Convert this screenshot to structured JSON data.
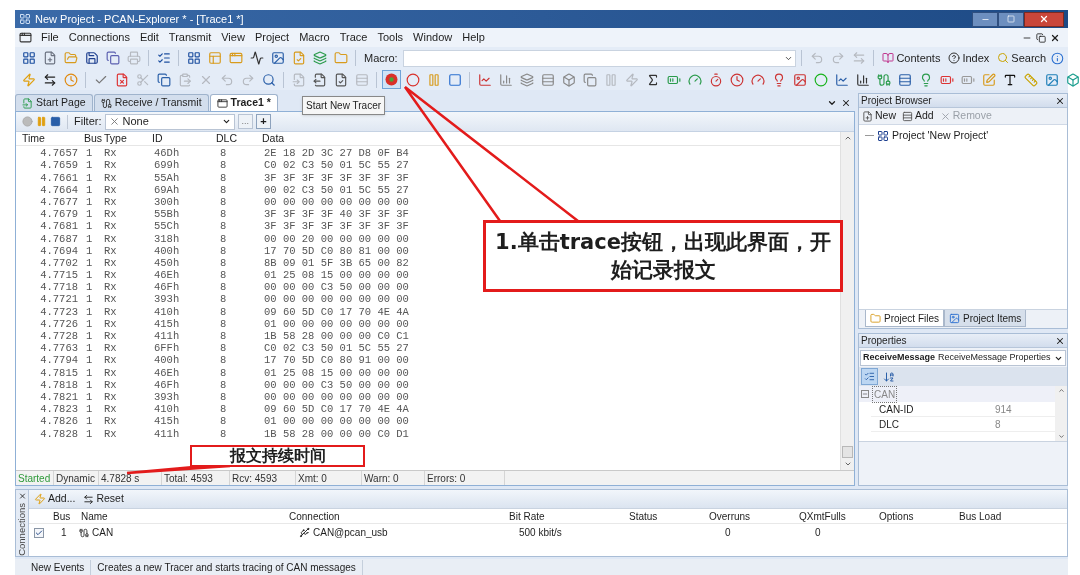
{
  "window": {
    "title": "New Project - PCAN-Explorer * - [Trace1 *]"
  },
  "menu": [
    "File",
    "Connections",
    "Edit",
    "Transmit",
    "View",
    "Project",
    "Macro",
    "Trace",
    "Tools",
    "Window",
    "Help"
  ],
  "toolbar": {
    "macro_label": "Macro:",
    "help_items": [
      "Contents",
      "Index",
      "Search"
    ]
  },
  "tracer_button": {
    "selected": true,
    "tooltip": "Start New Tracer"
  },
  "tabs": [
    {
      "label": "Start Page",
      "selected": false
    },
    {
      "label": "Receive / Transmit",
      "selected": false
    },
    {
      "label": "Trace1 *",
      "selected": true
    }
  ],
  "trace": {
    "filter_label": "Filter:",
    "filter_value": "None",
    "filter_more": "...",
    "filter_add": "+",
    "columns": [
      "Time",
      "Bus",
      "Type",
      "ID",
      "DLC",
      "Data"
    ],
    "rows": [
      [
        "4.7657",
        "1",
        "Rx",
        "46Dh",
        "8",
        "2E 18 2D 3C 27 D8 0F B4"
      ],
      [
        "4.7659",
        "1",
        "Rx",
        "699h",
        "8",
        "C0 02 C3 50 01 5C 55 27"
      ],
      [
        "4.7661",
        "1",
        "Rx",
        "55Ah",
        "8",
        "3F 3F 3F 3F 3F 3F 3F 3F"
      ],
      [
        "4.7664",
        "1",
        "Rx",
        "69Ah",
        "8",
        "00 02 C3 50 01 5C 55 27"
      ],
      [
        "4.7677",
        "1",
        "Rx",
        "300h",
        "8",
        "00 00 00 00 00 00 00 00"
      ],
      [
        "4.7679",
        "1",
        "Rx",
        "55Bh",
        "8",
        "3F 3F 3F 3F 40 3F 3F 3F"
      ],
      [
        "4.7681",
        "1",
        "Rx",
        "55Ch",
        "8",
        "3F 3F 3F 3F 3F 3F 3F 3F"
      ],
      [
        "4.7687",
        "1",
        "Rx",
        "318h",
        "8",
        "00 00 20 00 00 00 00 00"
      ],
      [
        "4.7694",
        "1",
        "Rx",
        "400h",
        "8",
        "17 70 5D C0 80 81 00 00"
      ],
      [
        "4.7702",
        "1",
        "Rx",
        "450h",
        "8",
        "8B 09 01 5F 3B 65 00 82"
      ],
      [
        "4.7715",
        "1",
        "Rx",
        "46Eh",
        "8",
        "01 25 08 15 00 00 00 00"
      ],
      [
        "4.7718",
        "1",
        "Rx",
        "46Fh",
        "8",
        "00 00 00 C3 50 00 00 00"
      ],
      [
        "4.7721",
        "1",
        "Rx",
        "393h",
        "8",
        "00 00 00 00 00 00 00 00"
      ],
      [
        "4.7723",
        "1",
        "Rx",
        "410h",
        "8",
        "09 60 5D C0 17 70 4E 4A"
      ],
      [
        "4.7726",
        "1",
        "Rx",
        "415h",
        "8",
        "01 00 00 00 00 00 00 00"
      ],
      [
        "4.7728",
        "1",
        "Rx",
        "411h",
        "8",
        "1B 58 28 00 00 00 C0 C1"
      ],
      [
        "4.7763",
        "1",
        "Rx",
        "6FFh",
        "8",
        "C0 02 C3 50 01 5C 55 27"
      ],
      [
        "4.7794",
        "1",
        "Rx",
        "400h",
        "8",
        "17 70 5D C0 80 91 00 00"
      ],
      [
        "4.7815",
        "1",
        "Rx",
        "46Eh",
        "8",
        "01 25 08 15 00 00 00 00"
      ],
      [
        "4.7818",
        "1",
        "Rx",
        "46Fh",
        "8",
        "00 00 00 C3 50 00 00 00"
      ],
      [
        "4.7821",
        "1",
        "Rx",
        "393h",
        "8",
        "00 00 00 00 00 00 00 00"
      ],
      [
        "4.7823",
        "1",
        "Rx",
        "410h",
        "8",
        "09 60 5D C0 17 70 4E 4A"
      ],
      [
        "4.7826",
        "1",
        "Rx",
        "415h",
        "8",
        "01 00 00 00 00 00 00 00"
      ],
      [
        "4.7828",
        "1",
        "Rx",
        "411h",
        "8",
        "1B 58 28 00 00 00 C0 D1"
      ]
    ],
    "status": [
      {
        "text": "Started",
        "kind": "state"
      },
      {
        "text": "Dynamic",
        "kind": "field"
      },
      {
        "text": "4.7828 s",
        "kind": "field"
      },
      {
        "text": "Total: 4593",
        "kind": "field"
      },
      {
        "text": "Rcv: 4593",
        "kind": "field"
      },
      {
        "text": "Xmt: 0",
        "kind": "field"
      },
      {
        "text": "Warn: 0",
        "kind": "field"
      },
      {
        "text": "Errors: 0",
        "kind": "field"
      }
    ]
  },
  "project_browser": {
    "title": "Project Browser",
    "actions": [
      {
        "label": "New",
        "disabled": false
      },
      {
        "label": "Add",
        "disabled": false
      },
      {
        "label": "Remove",
        "disabled": true
      }
    ],
    "tree": [
      {
        "label": "Project 'New Project'"
      }
    ],
    "tabs": [
      {
        "label": "Project Files",
        "selected": true
      },
      {
        "label": "Project Items",
        "selected": false
      }
    ]
  },
  "properties": {
    "title": "Properties",
    "object_name": "ReceiveMessage",
    "object_type": "ReceiveMessage Properties",
    "category": {
      "label": "CAN",
      "expanded": true
    },
    "rows": [
      {
        "name": "CAN-ID",
        "value": "914"
      },
      {
        "name": "DLC",
        "value": "8"
      }
    ]
  },
  "connections": {
    "title": "Connections",
    "actions": [
      "Add...",
      "Reset"
    ],
    "columns": [
      "Bus",
      "Name",
      "Connection",
      "Bit Rate",
      "Status",
      "Overruns",
      "QXmtFulls",
      "Options",
      "Bus Load"
    ],
    "rows": [
      {
        "checked": true,
        "bus": "1",
        "name": "CAN",
        "connection": "CAN@pcan_usb",
        "bit_rate": "500 kbit/s",
        "overruns": "0",
        "qxmtfulls": "0"
      }
    ]
  },
  "status_bar": [
    "New Events",
    "Creates a new Tracer and starts tracing of CAN messages"
  ],
  "annotations": [
    {
      "text": "1.单击trace按钮，出现此界面，开始记录报文"
    },
    {
      "text": "报文持续时间"
    }
  ]
}
